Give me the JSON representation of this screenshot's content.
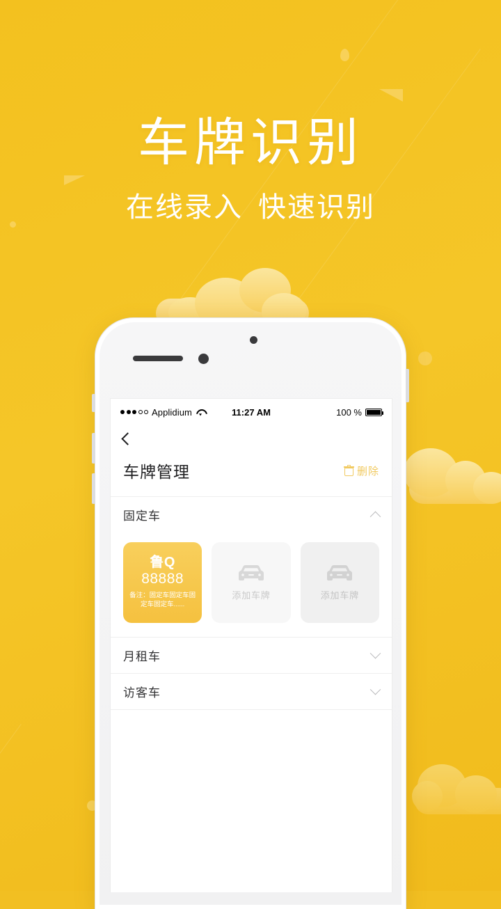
{
  "promo": {
    "title": "车牌识别",
    "subtitle_left": "在线录入",
    "subtitle_right": "快速识别"
  },
  "colors": {
    "background": "#f2bf22",
    "accent": "#f5c13f",
    "accent_soft": "#f1ca61",
    "cloud": "#fae29a",
    "card_placeholder": "#f7f7f7",
    "text_dark": "#1f1f21",
    "text_muted": "#c9c9c9"
  },
  "phone": {
    "status_bar": {
      "signal_dots_filled": 3,
      "signal_dots_empty": 2,
      "carrier": "Applidium",
      "wifi_icon": "wifi-icon",
      "time": "11:27 AM",
      "battery_percent": "100 %",
      "battery_icon": "battery-full-icon"
    },
    "nav": {
      "back_icon": "chevron-left-icon"
    },
    "header": {
      "title": "车牌管理",
      "delete_label": "删除",
      "delete_icon": "trash-icon"
    },
    "sections": [
      {
        "label": "固定车",
        "expanded": true,
        "chevron": "chevron-up-icon",
        "plates": [
          {
            "type": "plate",
            "province": "鲁Q",
            "number": "88888",
            "remark": "备注：固定车固定车固定车固定车......"
          },
          {
            "type": "add",
            "label": "添加车牌",
            "icon": "car-icon"
          },
          {
            "type": "add",
            "label": "添加车牌",
            "icon": "car-icon"
          }
        ]
      },
      {
        "label": "月租车",
        "expanded": false,
        "chevron": "chevron-down-icon",
        "plates": []
      },
      {
        "label": "访客车",
        "expanded": false,
        "chevron": "chevron-down-icon",
        "plates": []
      }
    ]
  }
}
